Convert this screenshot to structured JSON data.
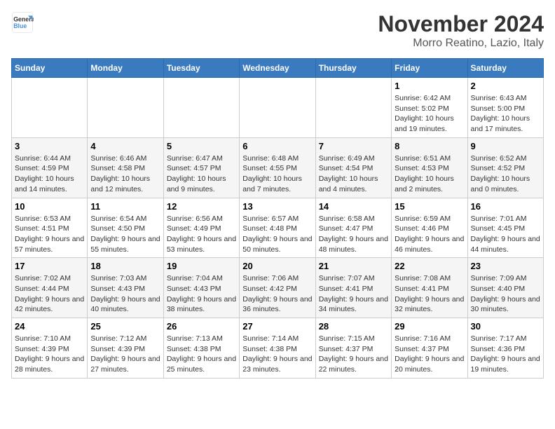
{
  "logo": {
    "line1": "General",
    "line2": "Blue"
  },
  "title": "November 2024",
  "location": "Morro Reatino, Lazio, Italy",
  "days_of_week": [
    "Sunday",
    "Monday",
    "Tuesday",
    "Wednesday",
    "Thursday",
    "Friday",
    "Saturday"
  ],
  "weeks": [
    [
      {
        "day": "",
        "info": ""
      },
      {
        "day": "",
        "info": ""
      },
      {
        "day": "",
        "info": ""
      },
      {
        "day": "",
        "info": ""
      },
      {
        "day": "",
        "info": ""
      },
      {
        "day": "1",
        "info": "Sunrise: 6:42 AM\nSunset: 5:02 PM\nDaylight: 10 hours and 19 minutes."
      },
      {
        "day": "2",
        "info": "Sunrise: 6:43 AM\nSunset: 5:00 PM\nDaylight: 10 hours and 17 minutes."
      }
    ],
    [
      {
        "day": "3",
        "info": "Sunrise: 6:44 AM\nSunset: 4:59 PM\nDaylight: 10 hours and 14 minutes."
      },
      {
        "day": "4",
        "info": "Sunrise: 6:46 AM\nSunset: 4:58 PM\nDaylight: 10 hours and 12 minutes."
      },
      {
        "day": "5",
        "info": "Sunrise: 6:47 AM\nSunset: 4:57 PM\nDaylight: 10 hours and 9 minutes."
      },
      {
        "day": "6",
        "info": "Sunrise: 6:48 AM\nSunset: 4:55 PM\nDaylight: 10 hours and 7 minutes."
      },
      {
        "day": "7",
        "info": "Sunrise: 6:49 AM\nSunset: 4:54 PM\nDaylight: 10 hours and 4 minutes."
      },
      {
        "day": "8",
        "info": "Sunrise: 6:51 AM\nSunset: 4:53 PM\nDaylight: 10 hours and 2 minutes."
      },
      {
        "day": "9",
        "info": "Sunrise: 6:52 AM\nSunset: 4:52 PM\nDaylight: 10 hours and 0 minutes."
      }
    ],
    [
      {
        "day": "10",
        "info": "Sunrise: 6:53 AM\nSunset: 4:51 PM\nDaylight: 9 hours and 57 minutes."
      },
      {
        "day": "11",
        "info": "Sunrise: 6:54 AM\nSunset: 4:50 PM\nDaylight: 9 hours and 55 minutes."
      },
      {
        "day": "12",
        "info": "Sunrise: 6:56 AM\nSunset: 4:49 PM\nDaylight: 9 hours and 53 minutes."
      },
      {
        "day": "13",
        "info": "Sunrise: 6:57 AM\nSunset: 4:48 PM\nDaylight: 9 hours and 50 minutes."
      },
      {
        "day": "14",
        "info": "Sunrise: 6:58 AM\nSunset: 4:47 PM\nDaylight: 9 hours and 48 minutes."
      },
      {
        "day": "15",
        "info": "Sunrise: 6:59 AM\nSunset: 4:46 PM\nDaylight: 9 hours and 46 minutes."
      },
      {
        "day": "16",
        "info": "Sunrise: 7:01 AM\nSunset: 4:45 PM\nDaylight: 9 hours and 44 minutes."
      }
    ],
    [
      {
        "day": "17",
        "info": "Sunrise: 7:02 AM\nSunset: 4:44 PM\nDaylight: 9 hours and 42 minutes."
      },
      {
        "day": "18",
        "info": "Sunrise: 7:03 AM\nSunset: 4:43 PM\nDaylight: 9 hours and 40 minutes."
      },
      {
        "day": "19",
        "info": "Sunrise: 7:04 AM\nSunset: 4:43 PM\nDaylight: 9 hours and 38 minutes."
      },
      {
        "day": "20",
        "info": "Sunrise: 7:06 AM\nSunset: 4:42 PM\nDaylight: 9 hours and 36 minutes."
      },
      {
        "day": "21",
        "info": "Sunrise: 7:07 AM\nSunset: 4:41 PM\nDaylight: 9 hours and 34 minutes."
      },
      {
        "day": "22",
        "info": "Sunrise: 7:08 AM\nSunset: 4:41 PM\nDaylight: 9 hours and 32 minutes."
      },
      {
        "day": "23",
        "info": "Sunrise: 7:09 AM\nSunset: 4:40 PM\nDaylight: 9 hours and 30 minutes."
      }
    ],
    [
      {
        "day": "24",
        "info": "Sunrise: 7:10 AM\nSunset: 4:39 PM\nDaylight: 9 hours and 28 minutes."
      },
      {
        "day": "25",
        "info": "Sunrise: 7:12 AM\nSunset: 4:39 PM\nDaylight: 9 hours and 27 minutes."
      },
      {
        "day": "26",
        "info": "Sunrise: 7:13 AM\nSunset: 4:38 PM\nDaylight: 9 hours and 25 minutes."
      },
      {
        "day": "27",
        "info": "Sunrise: 7:14 AM\nSunset: 4:38 PM\nDaylight: 9 hours and 23 minutes."
      },
      {
        "day": "28",
        "info": "Sunrise: 7:15 AM\nSunset: 4:37 PM\nDaylight: 9 hours and 22 minutes."
      },
      {
        "day": "29",
        "info": "Sunrise: 7:16 AM\nSunset: 4:37 PM\nDaylight: 9 hours and 20 minutes."
      },
      {
        "day": "30",
        "info": "Sunrise: 7:17 AM\nSunset: 4:36 PM\nDaylight: 9 hours and 19 minutes."
      }
    ]
  ]
}
